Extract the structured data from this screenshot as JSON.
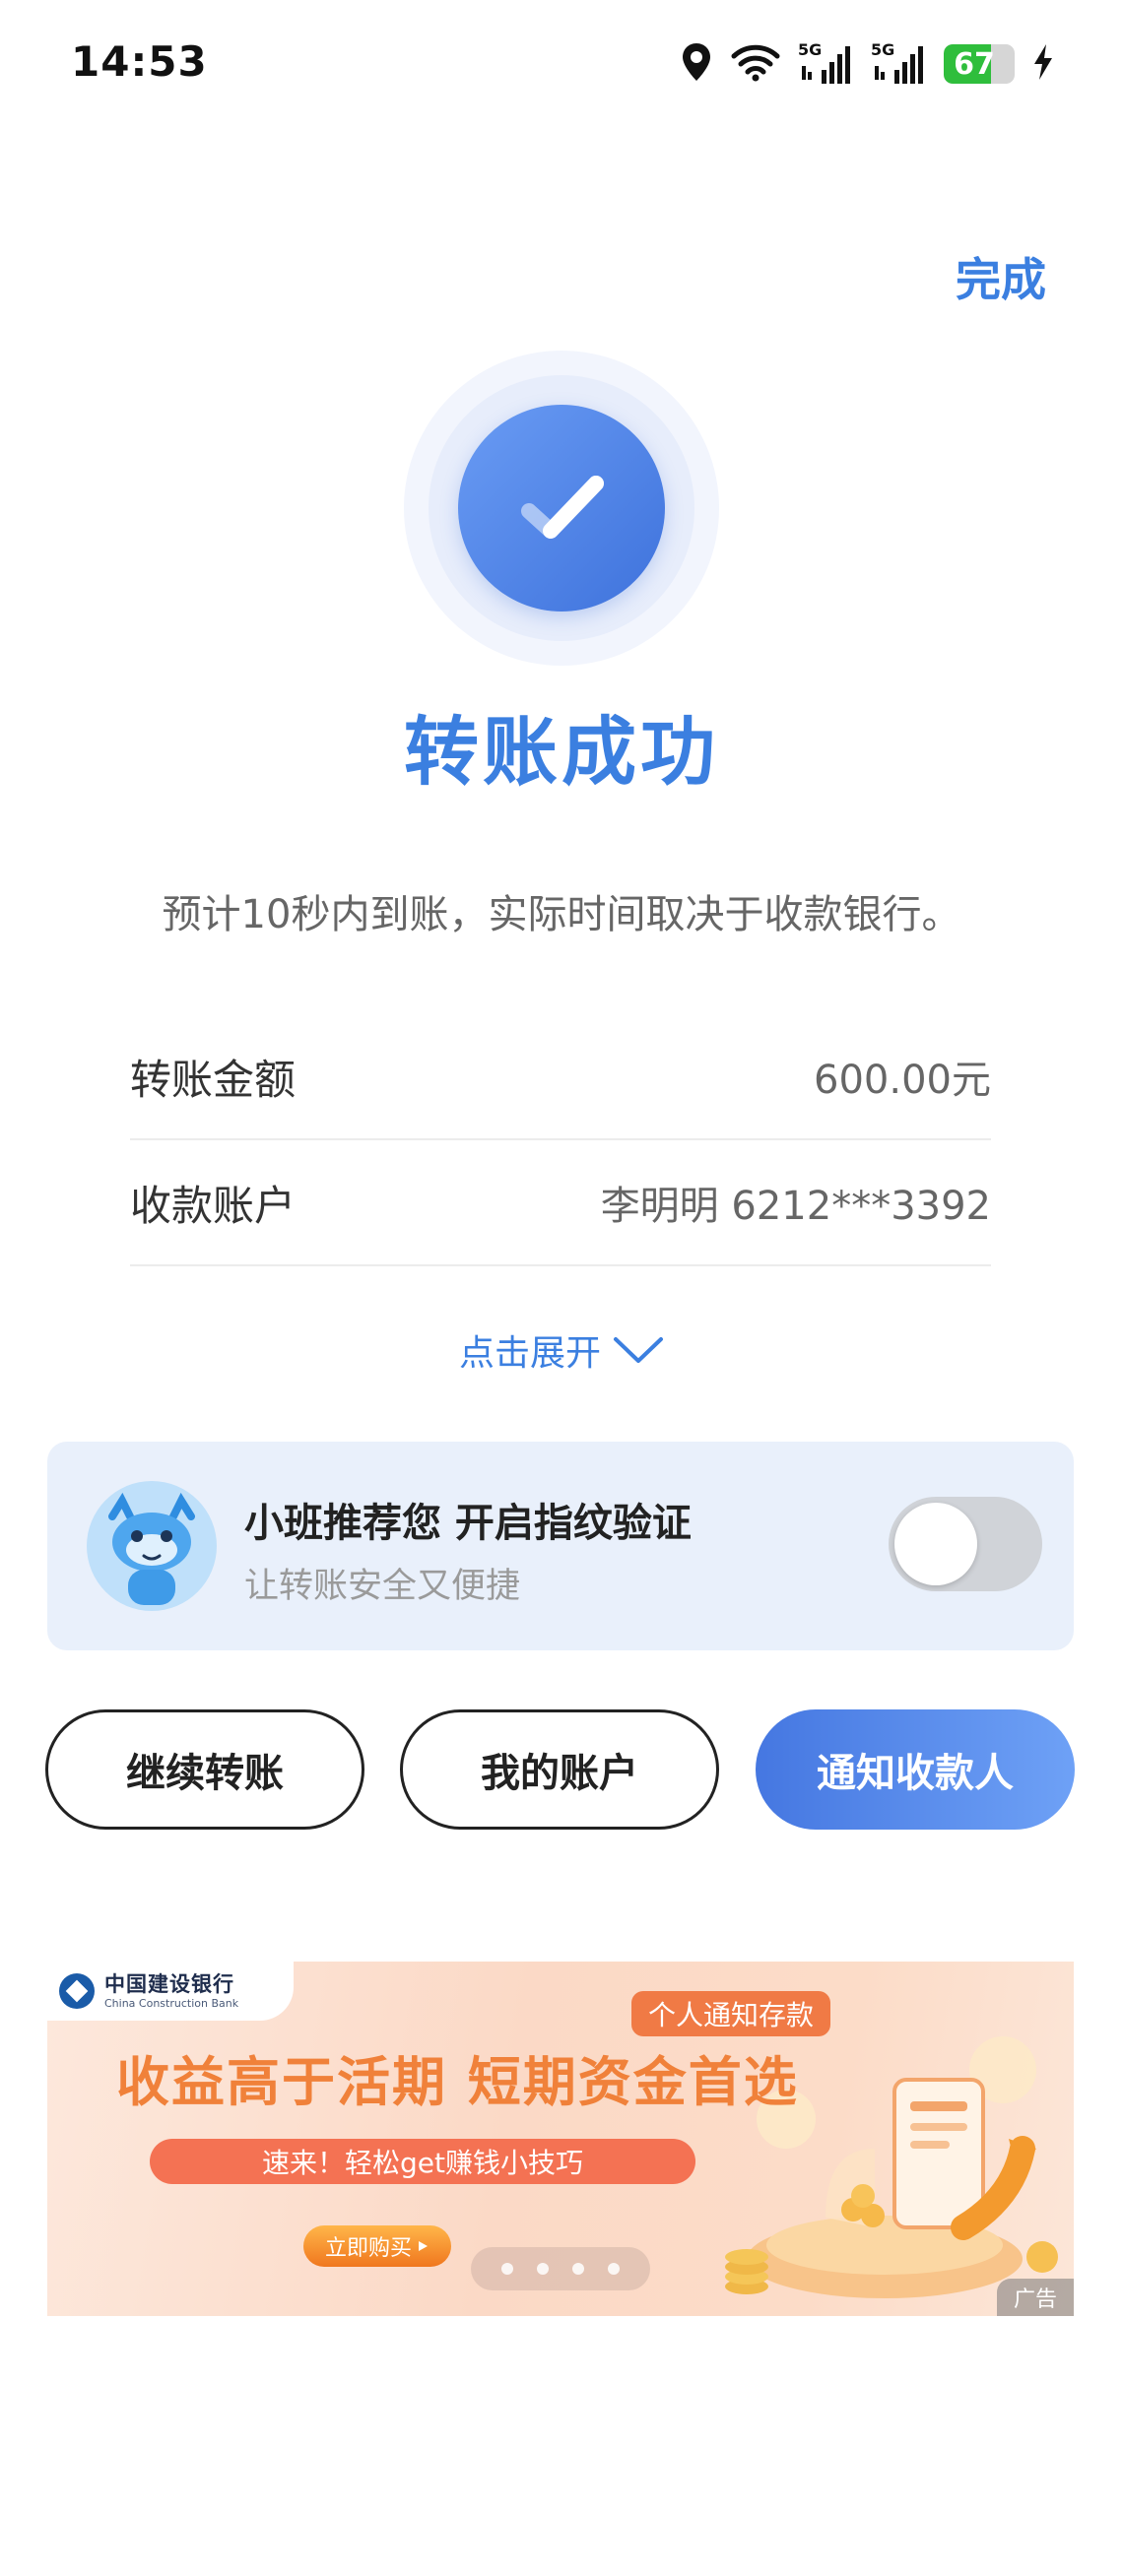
{
  "status_bar": {
    "time": "14:53",
    "network_1": "5G",
    "network_2": "5G",
    "battery": "67",
    "battery_level": 0.67,
    "icons": [
      "location-icon",
      "wifi-icon",
      "signal-icon",
      "signal-icon",
      "battery-icon",
      "charging-icon"
    ]
  },
  "header": {
    "done_label": "完成"
  },
  "result": {
    "title": "转账成功",
    "subtitle": "预计10秒内到账，实际时间取决于收款银行。"
  },
  "details": [
    {
      "label": "转账金额",
      "value": "600.00元"
    },
    {
      "label": "收款账户",
      "value": "李明明 6212***3392"
    }
  ],
  "expand_label": "点击展开",
  "fingerprint_card": {
    "title": "小班推荐您 开启指纹验证",
    "subtitle": "让转账安全又便捷",
    "toggle_on": false
  },
  "actions": {
    "continue_label": "继续转账",
    "accounts_label": "我的账户",
    "notify_label": "通知收款人"
  },
  "ad": {
    "bank_name": "中国建设银行",
    "bank_name_en": "China Construction Bank",
    "tag": "个人通知存款",
    "headline": "收益高于活期 短期资金首选",
    "pill": "速来！轻松get赚钱小技巧",
    "buy_label": "立即购买",
    "ad_label": "广告",
    "slides": 4
  },
  "colors": {
    "accent": "#3b7fe0",
    "primary_gradient_start": "#4577e1",
    "primary_gradient_end": "#6ea1f6",
    "card_bg": "#e9f0fb",
    "ad_orange": "#f0813a"
  }
}
